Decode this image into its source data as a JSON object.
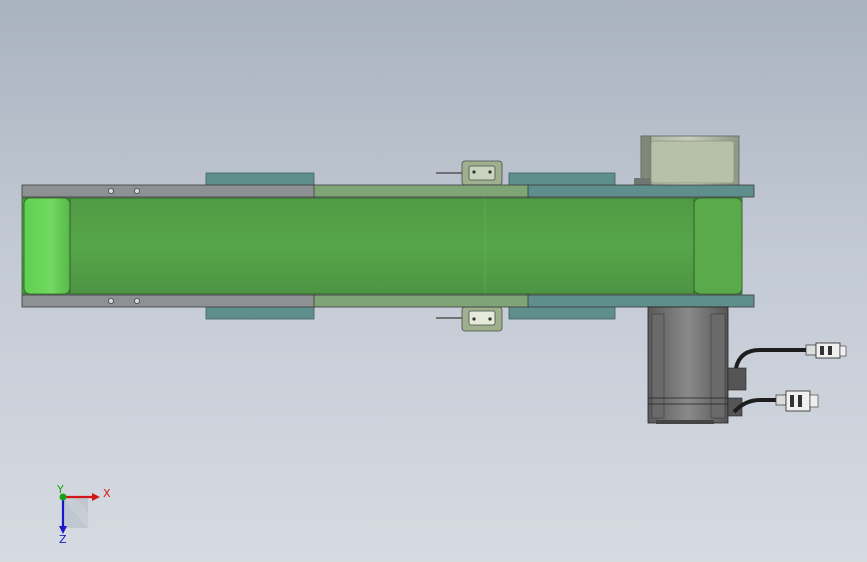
{
  "view": {
    "background_top": "#a9b2c0",
    "background_bottom": "#d6dbe2"
  },
  "model": {
    "belt_color": "#54a147",
    "belt_end_color": "#6ccf5a",
    "frame_rail_color": "#8e9194",
    "side_plate_color": "#5e8f8c",
    "guide_color": "#7fa476",
    "motor_housing_color": "#9aa295",
    "motor_body_color": "#7a7a7a",
    "cable_color": "#1e1e1e"
  },
  "triad": {
    "x_label": "X",
    "y_label": "Y",
    "z_label": "Z",
    "x_color": "#d01818",
    "y_color": "#18a018",
    "z_color": "#1818c8"
  }
}
